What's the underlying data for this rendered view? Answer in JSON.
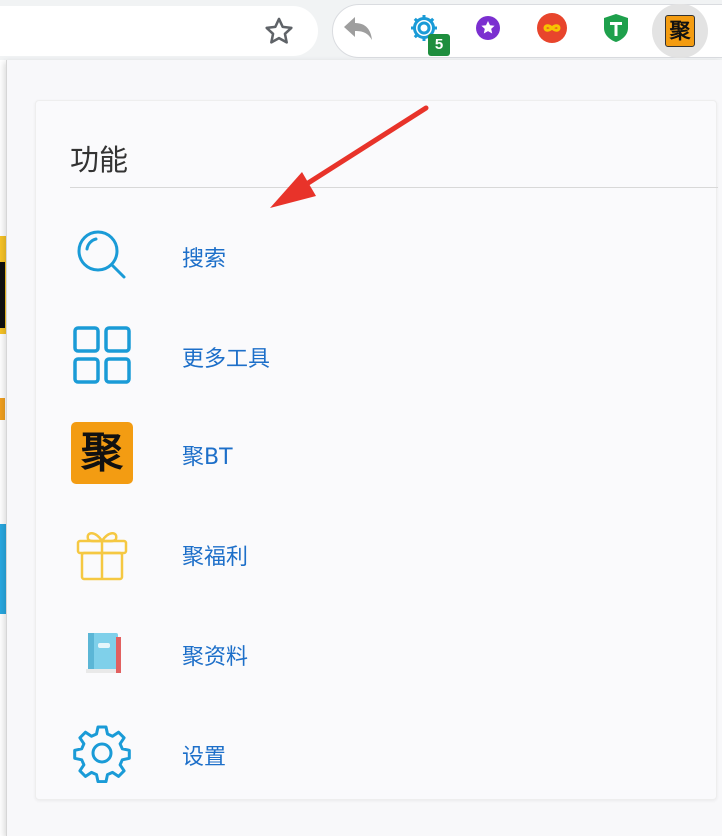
{
  "toolbar": {
    "extension_badge": "5",
    "ju_extension_glyph": "聚",
    "icons": [
      "star-icon",
      "back-arrow-icon",
      "gear-icon",
      "purple-star-icon",
      "infinity-icon",
      "shield-t-icon",
      "ju-icon"
    ]
  },
  "popup": {
    "title": "功能",
    "items": [
      {
        "label": "搜索",
        "icon": "search-icon"
      },
      {
        "label": "更多工具",
        "icon": "grid-icon"
      },
      {
        "label": "聚BT",
        "icon": "ju-icon",
        "glyph": "聚"
      },
      {
        "label": "聚福利",
        "icon": "gift-icon"
      },
      {
        "label": "聚资料",
        "icon": "book-icon"
      },
      {
        "label": "设置",
        "icon": "settings-gear-icon"
      }
    ]
  },
  "colors": {
    "accent": "#1d6fc9",
    "icon_blue": "#1a9bd7",
    "ju_orange": "#f39c12",
    "badge_green": "#1e8e3e",
    "arrow_red": "#e8332a"
  }
}
